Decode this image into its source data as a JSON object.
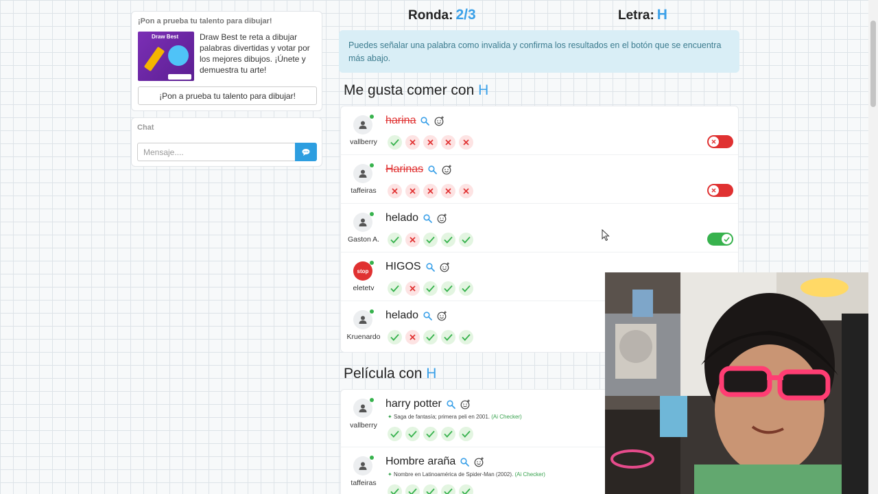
{
  "sidebar": {
    "promo": {
      "title": "¡Pon a prueba tu talento para dibujar!",
      "image_label": "Draw Best",
      "description": "Draw Best te reta a dibujar palabras divertidas y votar por los mejores dibujos. ¡Únete y demuestra tu arte!",
      "button_label": "¡Pon a prueba tu talento para dibujar!"
    },
    "chat": {
      "title": "Chat",
      "input_placeholder": "Mensaje....",
      "send_icon": "chat-bubble-icon"
    }
  },
  "header": {
    "round_label": "Ronda:",
    "round_value": "2/3",
    "letter_label": "Letra:",
    "letter_value": "H"
  },
  "info_text": "Puedes señalar una palabra como invalida y confirma los resultados en el botón que se encuentra más abajo.",
  "categories": [
    {
      "title_prefix": "Me gusta comer con",
      "letter": "H",
      "answers": [
        {
          "user": "vallberry",
          "word": "harina",
          "invalid": true,
          "votes": [
            "yes",
            "no",
            "no",
            "no",
            "no"
          ],
          "toggle": "off"
        },
        {
          "user": "taffeiras",
          "word": "Harinas",
          "invalid": true,
          "votes": [
            "no",
            "no",
            "no",
            "no",
            "no"
          ],
          "toggle": "off"
        },
        {
          "user": "Gaston A.",
          "word": "helado",
          "invalid": false,
          "votes": [
            "yes",
            "no",
            "yes",
            "yes",
            "yes"
          ],
          "toggle": "on"
        },
        {
          "user": "eletetv",
          "word": "HIGOS",
          "invalid": false,
          "votes": [
            "yes",
            "no",
            "yes",
            "yes",
            "yes"
          ],
          "toggle": "on"
        },
        {
          "user": "Kruenardo",
          "word": "helado",
          "invalid": false,
          "votes": [
            "yes",
            "no",
            "yes",
            "yes",
            "yes"
          ],
          "toggle": "on"
        }
      ]
    },
    {
      "title_prefix": "Película con",
      "letter": "H",
      "answers": [
        {
          "user": "vallberry",
          "word": "harry potter",
          "note": "Saga de fantasía; primera peli en 2001.",
          "note_tag": "(Ai Checker)",
          "votes": [
            "yes",
            "yes",
            "yes",
            "yes",
            "yes"
          ]
        },
        {
          "user": "taffeiras",
          "word": "Hombre araña",
          "note": "Nombre en Latinoamérica de Spider-Man (2002).",
          "note_tag": "(Ai Checker)",
          "votes": [
            "yes",
            "yes",
            "yes",
            "yes",
            "yes"
          ]
        }
      ]
    }
  ],
  "colors": {
    "accent": "#3aa0e8",
    "valid": "#37b24d",
    "invalid": "#e03131",
    "info_bg": "#d9eef6",
    "info_text": "#3b7b8e"
  }
}
